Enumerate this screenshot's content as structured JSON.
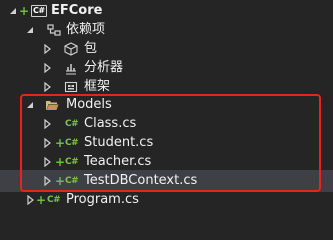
{
  "solution_explorer": {
    "project": {
      "name": "EFCore",
      "icon": "csharp-project-icon",
      "pending_add": "+"
    },
    "dependencies": {
      "label": "依赖项",
      "icon": "dependencies-icon",
      "children": [
        {
          "label": "包",
          "icon": "package-icon"
        },
        {
          "label": "分析器",
          "icon": "analyzer-icon"
        },
        {
          "label": "框架",
          "icon": "framework-icon"
        }
      ]
    },
    "models_folder": {
      "label": "Models",
      "icon": "folder-open-icon",
      "files": [
        {
          "label": "Class.cs",
          "icon": "csharp-file-icon",
          "pending_add": ""
        },
        {
          "label": "Student.cs",
          "icon": "csharp-file-icon",
          "pending_add": "+"
        },
        {
          "label": "Teacher.cs",
          "icon": "csharp-file-icon",
          "pending_add": "+"
        },
        {
          "label": "TestDBContext.cs",
          "icon": "csharp-file-icon",
          "pending_add": "+",
          "selected": true
        }
      ]
    },
    "program_file": {
      "label": "Program.cs",
      "icon": "csharp-file-icon",
      "pending_add": "+"
    },
    "icon_text": {
      "csharp": "C#"
    },
    "colors": {
      "background": "#252526",
      "selection": "#3f3f46",
      "highlight_border": "#e8221f",
      "git_added": "#6dbd45",
      "csharp_icon": "#7ec44a",
      "folder": "#dcb67a"
    }
  }
}
